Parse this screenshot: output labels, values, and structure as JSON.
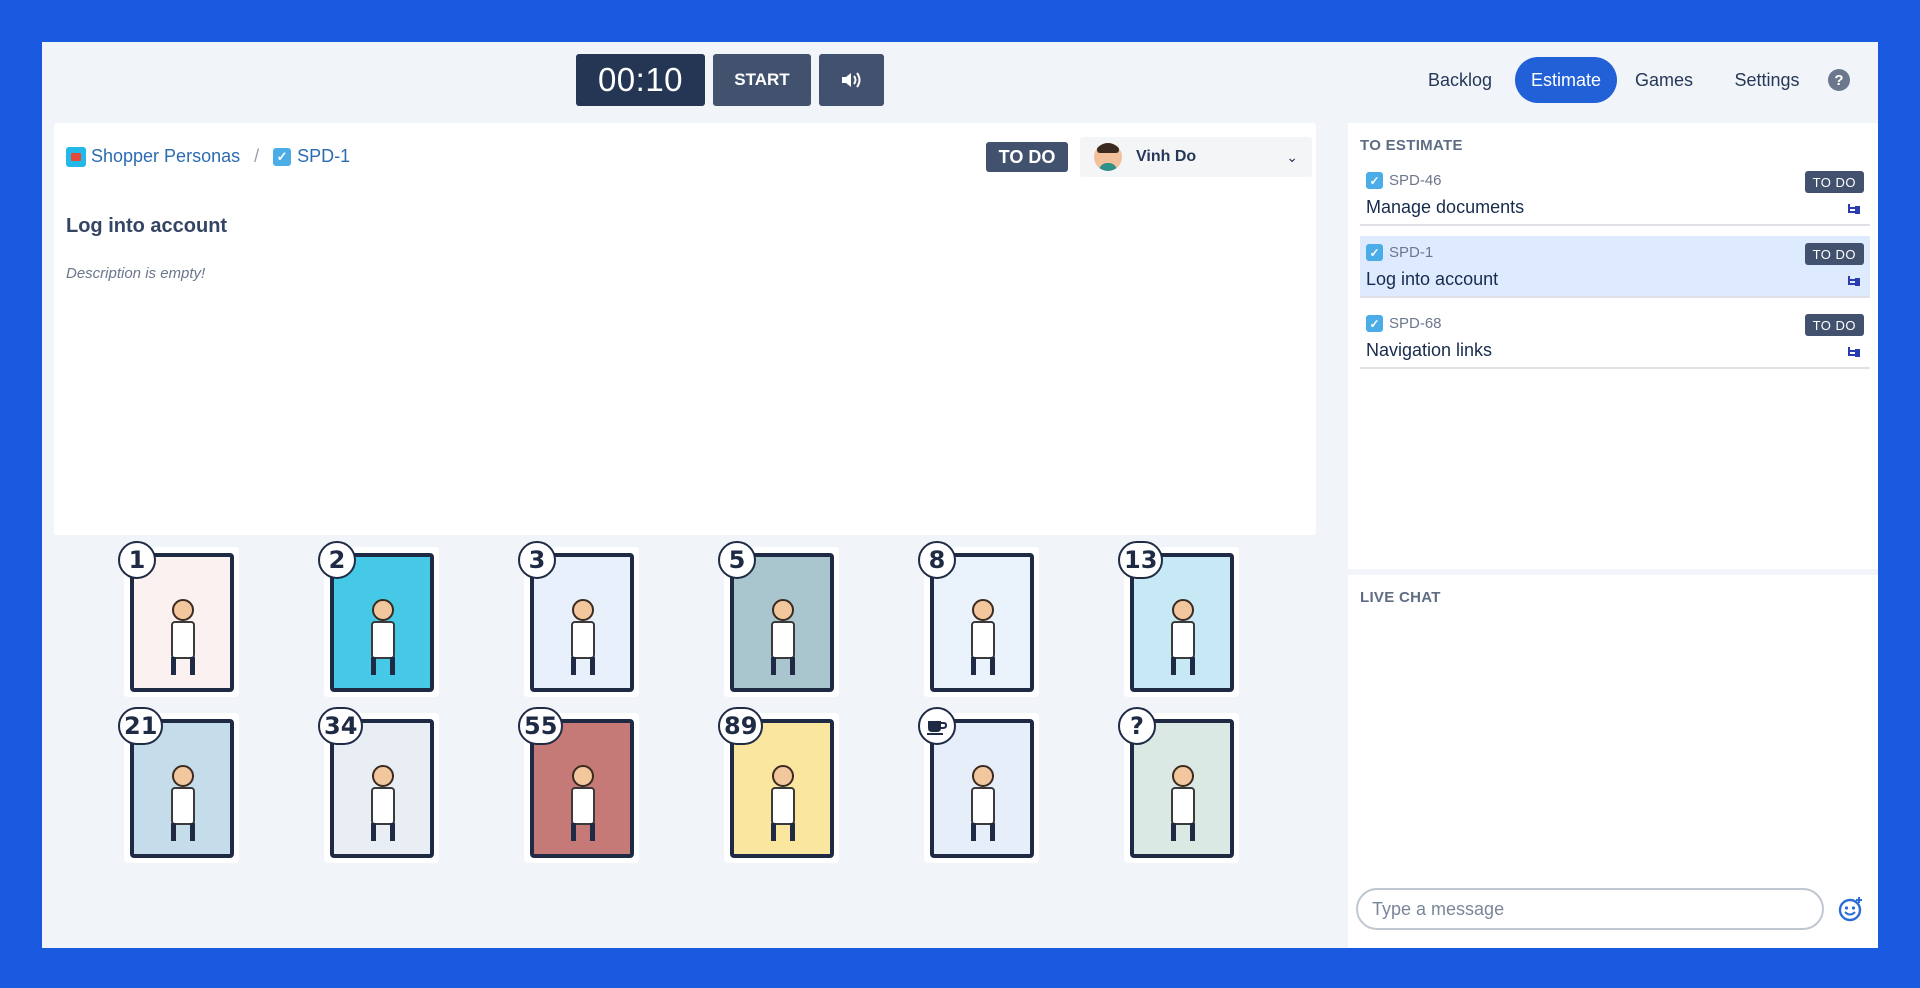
{
  "timer": {
    "display": "00:10"
  },
  "controls": {
    "start_label": "START"
  },
  "nav": {
    "backlog": "Backlog",
    "estimate": "Estimate",
    "games": "Games",
    "settings": "Settings",
    "help": "?"
  },
  "issue": {
    "project": "Shopper Personas",
    "separator": "/",
    "key": "SPD-1",
    "status": "TO DO",
    "assignee": "Vinh Do",
    "title": "Log into account",
    "description": "Description is empty!"
  },
  "cards": [
    {
      "value": "1",
      "bg": "#fbf1f0"
    },
    {
      "value": "2",
      "bg": "#45c9e6"
    },
    {
      "value": "3",
      "bg": "#e7f0fb"
    },
    {
      "value": "5",
      "bg": "#a9c6cf"
    },
    {
      "value": "8",
      "bg": "#eaf2fb"
    },
    {
      "value": "13",
      "bg": "#c7e9f5"
    },
    {
      "value": "21",
      "bg": "#c5ddea"
    },
    {
      "value": "34",
      "bg": "#e9eef5"
    },
    {
      "value": "55",
      "bg": "#c57a78"
    },
    {
      "value": "89",
      "bg": "#fbe6a0"
    },
    {
      "value": "coffee",
      "bg": "#e5eef9"
    },
    {
      "value": "?",
      "bg": "#dbe9e4"
    }
  ],
  "sidebar": {
    "to_estimate_heading": "TO ESTIMATE",
    "items": [
      {
        "key": "SPD-46",
        "title": "Manage documents",
        "status": "TO DO"
      },
      {
        "key": "SPD-1",
        "title": "Log into account",
        "status": "TO DO"
      },
      {
        "key": "SPD-68",
        "title": "Navigation links",
        "status": "TO DO"
      }
    ],
    "live_chat_heading": "LIVE CHAT",
    "chat_placeholder": "Type a message"
  },
  "colors": {
    "frame": "#1a5ae0",
    "accent": "#2160d6",
    "dark": "#243653"
  },
  "icons": {
    "sound": "speaker-icon",
    "emoji": "smiley-icon",
    "subtask": "subtask-icon",
    "coffee": "coffee-cup-icon"
  }
}
